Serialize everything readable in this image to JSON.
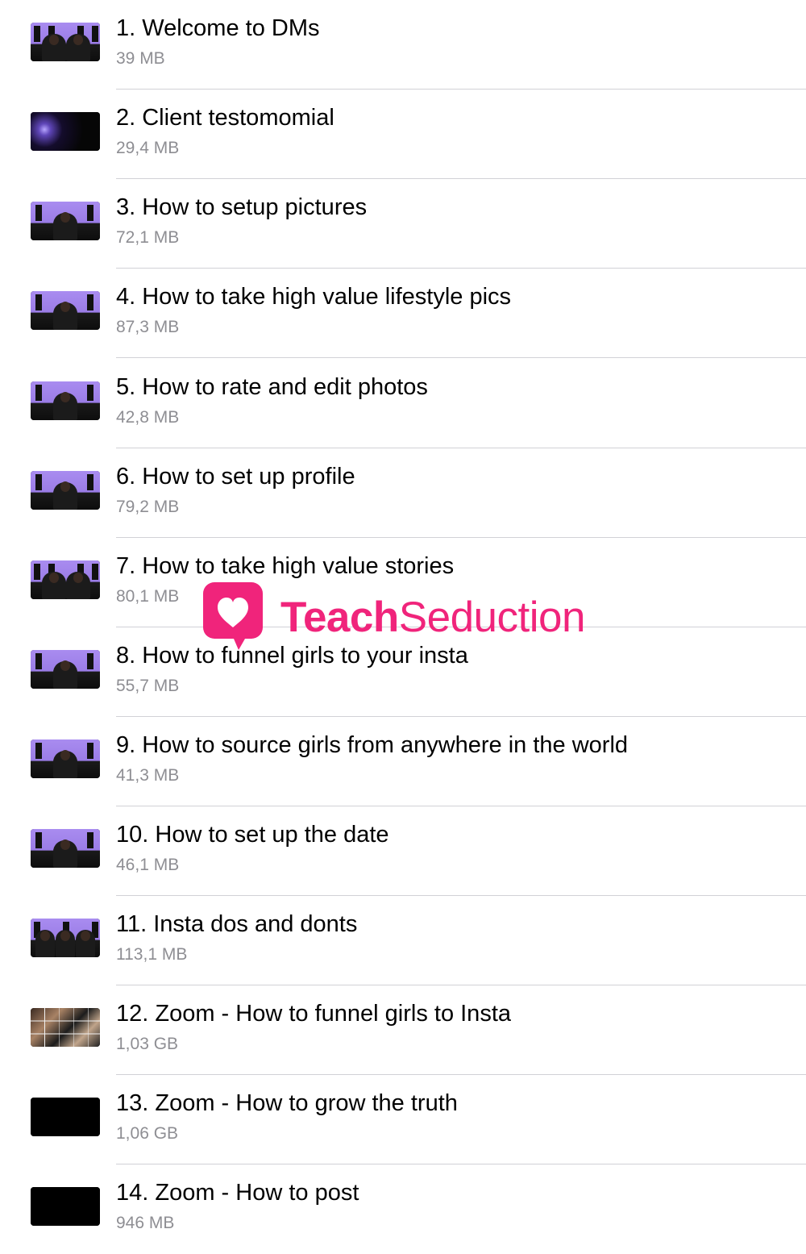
{
  "files": [
    {
      "title": "1. Welcome to DMs",
      "size": "39 MB",
      "thumbnail": "video-thumbnail-two-people"
    },
    {
      "title": "2. Client testomomial",
      "size": "29,4 MB",
      "thumbnail": "video-thumbnail-dark"
    },
    {
      "title": "3. How to setup pictures",
      "size": "72,1 MB",
      "thumbnail": "video-thumbnail-person"
    },
    {
      "title": "4. How to take high value lifestyle pics",
      "size": "87,3 MB",
      "thumbnail": "video-thumbnail-person"
    },
    {
      "title": "5. How to rate and edit photos",
      "size": "42,8 MB",
      "thumbnail": "video-thumbnail-person"
    },
    {
      "title": "6. How to set up profile",
      "size": "79,2 MB",
      "thumbnail": "video-thumbnail-person"
    },
    {
      "title": "7. How to take high value stories",
      "size": "80,1 MB",
      "thumbnail": "video-thumbnail-two-people"
    },
    {
      "title": "8. How to funnel girls to your insta",
      "size": "55,7 MB",
      "thumbnail": "video-thumbnail-person"
    },
    {
      "title": "9. How to source girls from anywhere in the world",
      "size": "41,3 MB",
      "thumbnail": "video-thumbnail-person"
    },
    {
      "title": "10. How to set up the date",
      "size": "46,1 MB",
      "thumbnail": "video-thumbnail-person"
    },
    {
      "title": "11. Insta dos and donts",
      "size": "113,1 MB",
      "thumbnail": "video-thumbnail-three-people"
    },
    {
      "title": "12. Zoom - How to funnel girls to Insta",
      "size": "1,03 GB",
      "thumbnail": "video-thumbnail-zoom-grid"
    },
    {
      "title": "13. Zoom - How to grow the truth",
      "size": "1,06 GB",
      "thumbnail": "video-thumbnail-black"
    },
    {
      "title": "14. Zoom - How to post",
      "size": "946 MB",
      "thumbnail": "video-thumbnail-black"
    }
  ],
  "watermark": {
    "brand_bold": "Teach",
    "brand_regular": "Seduction",
    "icon": "heart-speech-bubble-icon",
    "color": "#f0247b"
  }
}
